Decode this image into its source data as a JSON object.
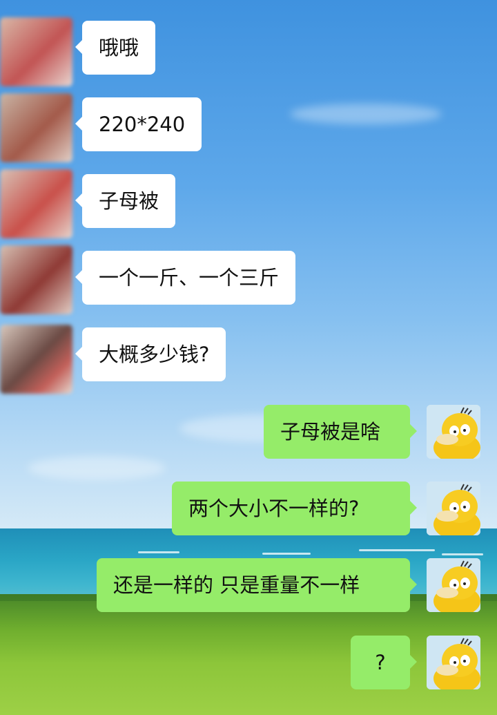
{
  "chat": {
    "incoming_messages": [
      {
        "text": "哦哦"
      },
      {
        "text": "220*240"
      },
      {
        "text": "子母被"
      },
      {
        "text": "一个一斤、一个三斤"
      },
      {
        "text": "大概多少钱?"
      }
    ],
    "outgoing_messages": [
      {
        "text": "子母被是啥"
      },
      {
        "text": "两个大小不一样的?"
      },
      {
        "text": "还是一样的 只是重量不一样"
      },
      {
        "text": "?"
      }
    ]
  },
  "colors": {
    "incoming_bubble": "#ffffff",
    "outgoing_bubble": "#95ec69"
  },
  "icons": {
    "contact_avatar": "blurred-avatar-icon",
    "self_avatar": "psyduck-avatar-icon"
  }
}
